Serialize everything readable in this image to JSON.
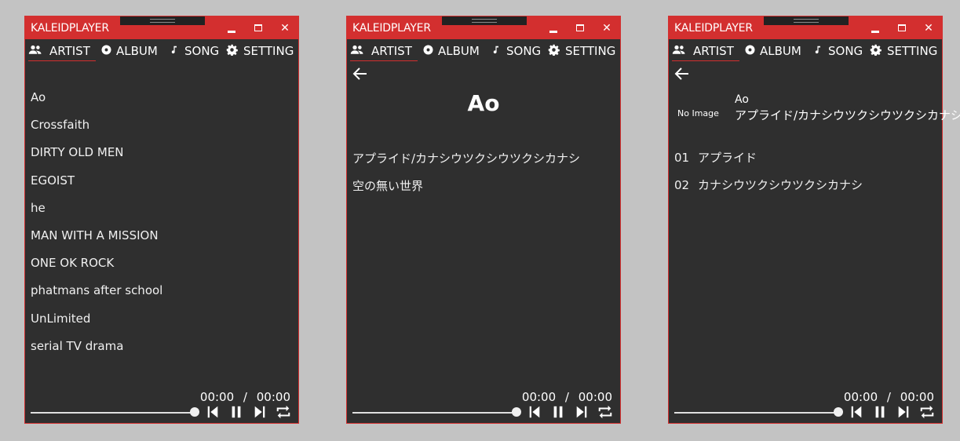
{
  "app": {
    "title": "KALEIDPLAYER",
    "accent": "#d32f2f",
    "background": "#2f2f2f"
  },
  "tabs": [
    {
      "label": "ARTIST",
      "icon": "people-icon"
    },
    {
      "label": "ALBUM",
      "icon": "disc-icon"
    },
    {
      "label": "SONG",
      "icon": "music-note-icon"
    },
    {
      "label": "SETTING",
      "icon": "gear-icon"
    }
  ],
  "windows": [
    {
      "view": "artist-list",
      "artists": [
        "Ao",
        "Crossfaith",
        "DIRTY OLD MEN",
        "EGOIST",
        "he",
        "MAN WITH A MISSION",
        "ONE OK ROCK",
        "phatmans after school",
        "UnLimited",
        "serial TV drama"
      ]
    },
    {
      "view": "artist-detail",
      "artist": "Ao",
      "albums": [
        "アプライド/カナシウツクシウツクシカナシ",
        "空の無い世界"
      ]
    },
    {
      "view": "album-detail",
      "image_placeholder": "No Image",
      "artist": "Ao",
      "album": "アプライド/カナシウツクシウツクシカナシ",
      "tracks": [
        {
          "no": "01",
          "title": "アプライド"
        },
        {
          "no": "02",
          "title": "カナシウツクシウツクシカナシ"
        }
      ]
    }
  ],
  "player": {
    "elapsed": "00:00",
    "separator": "/",
    "duration": "00:00",
    "progress": 1.0
  }
}
